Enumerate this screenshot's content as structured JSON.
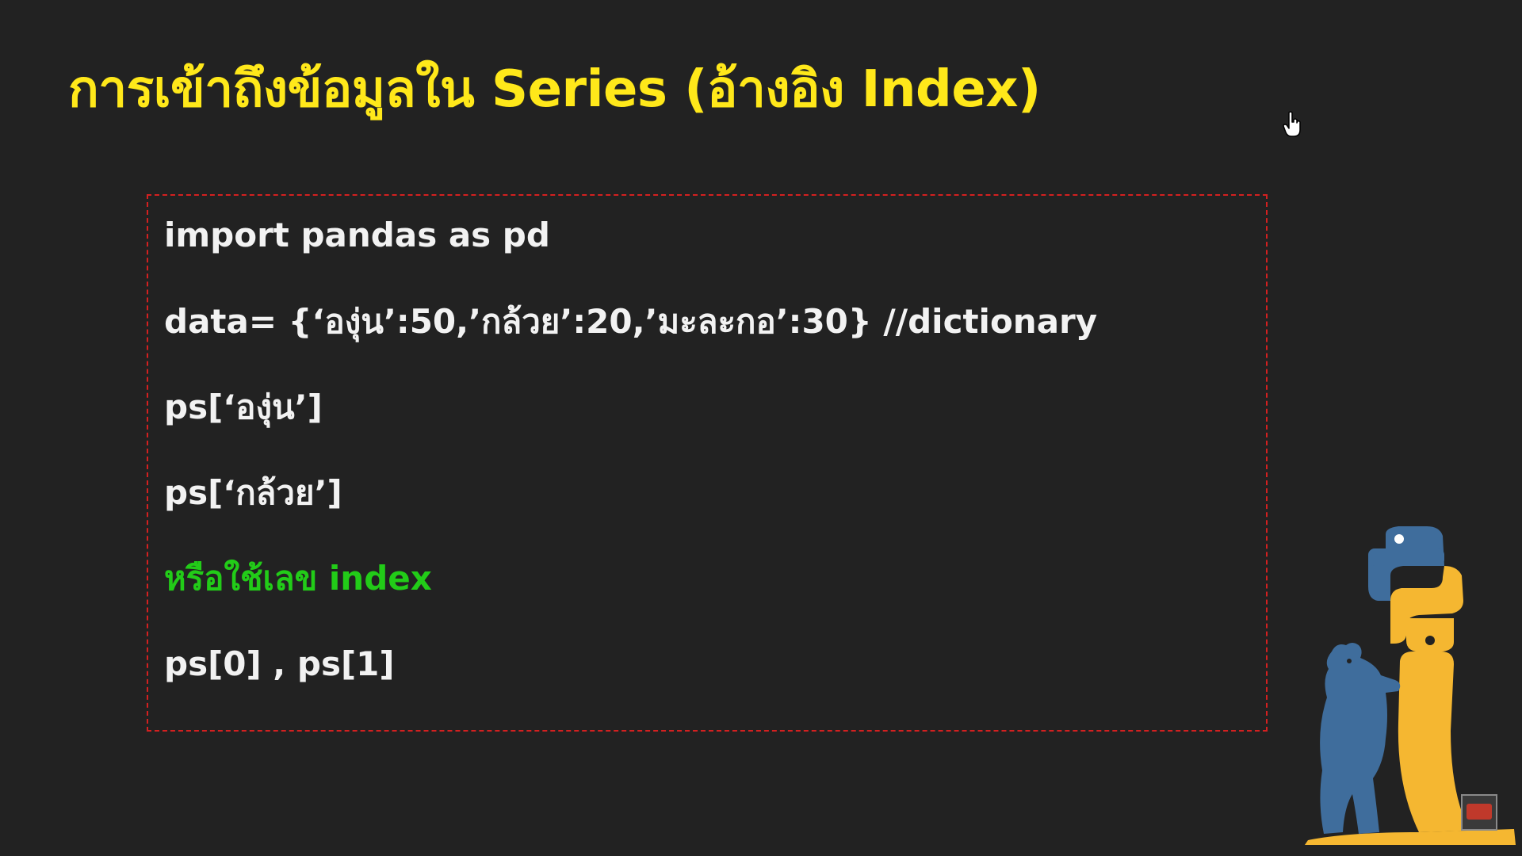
{
  "slide": {
    "title": "การเข้าถึงข้อมูลใน Series (อ้างอิง Index)",
    "code_lines": [
      "import pandas as pd",
      "data= {‘องุ่น’:50,’กล้วย’:20,’มะละกอ’:30} //dictionary",
      "ps[‘องุ่น’]",
      "ps[‘กล้วย’]",
      "หรือใช้เลข index",
      "ps[0] , ps[1]"
    ]
  },
  "colors": {
    "background": "#222222",
    "title": "#ffe81a",
    "code_text": "#f2f2f2",
    "note_text": "#22cc18",
    "box_border": "#d42020",
    "python_blue": "#3f6d9c",
    "python_yellow": "#f5b731"
  },
  "icons": {
    "cursor": "hand-pointer-icon",
    "mascot": "python-bear-logo-icon",
    "badge": "subscribe-badge-icon"
  }
}
